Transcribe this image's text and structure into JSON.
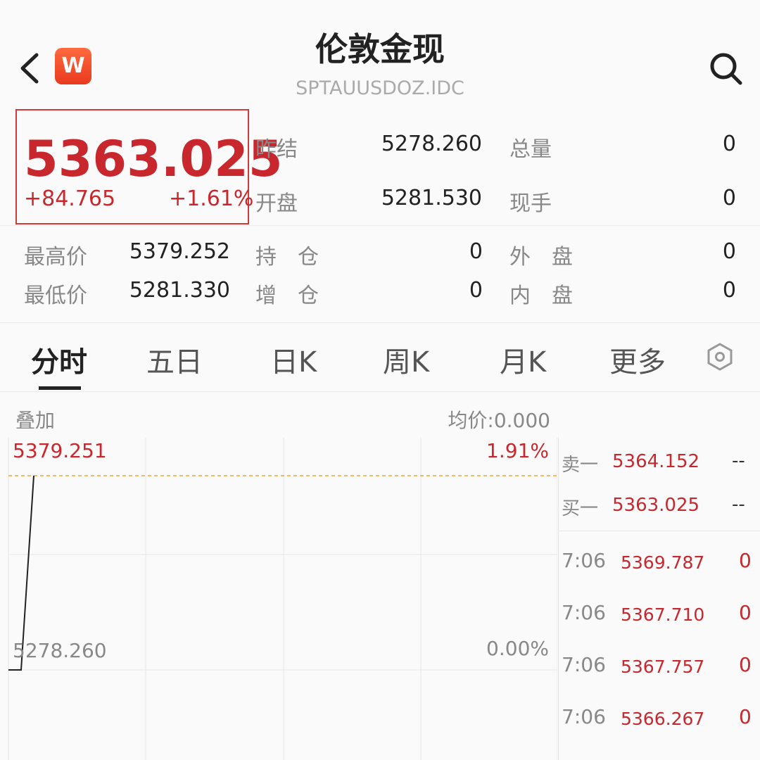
{
  "header": {
    "title": "伦敦金现",
    "code": "SPTAUUSDOZ.IDC",
    "badge": "W"
  },
  "quote": {
    "price": "5363.025",
    "change": "+84.765",
    "change_pct": "+1.61%"
  },
  "stats_top": [
    {
      "label": "昨结",
      "value": "5278.260"
    },
    {
      "label": "总量",
      "value": "0"
    },
    {
      "label": "开盘",
      "value": "5281.530"
    },
    {
      "label": "现手",
      "value": "0"
    }
  ],
  "stats_bottom": [
    {
      "label": "最高价",
      "value": "5379.252"
    },
    {
      "label": "持　仓",
      "value": "0"
    },
    {
      "label": "外　盘",
      "value": "0"
    },
    {
      "label": "最低价",
      "value": "5281.330"
    },
    {
      "label": "增　仓",
      "value": "0"
    },
    {
      "label": "内　盘",
      "value": "0"
    }
  ],
  "tabs": [
    "分时",
    "五日",
    "日K",
    "周K",
    "月K",
    "更多"
  ],
  "chart": {
    "overlay_label": "叠加",
    "avg_price": "均价:0.000",
    "high_price": "5379.251",
    "low_price": "5278.260",
    "high_pct": "1.91%",
    "low_pct": "0.00%"
  },
  "chart_data": {
    "type": "line",
    "x": [
      0,
      1,
      2
    ],
    "values": [
      5278.26,
      5278.26,
      5379.251
    ],
    "ylim": [
      5278.26,
      5379.251
    ],
    "reference_line": 5379.251
  },
  "order_book": [
    {
      "label": "卖一",
      "price": "5364.152",
      "qty": "--"
    },
    {
      "label": "买一",
      "price": "5363.025",
      "qty": "--"
    }
  ],
  "ticks": [
    {
      "time": "7:06",
      "price": "5369.787",
      "vol": "0"
    },
    {
      "time": "7:06",
      "price": "5367.710",
      "vol": "0"
    },
    {
      "time": "7:06",
      "price": "5367.757",
      "vol": "0"
    },
    {
      "time": "7:06",
      "price": "5366.267",
      "vol": "0"
    }
  ],
  "colors": {
    "up": "#c8282d",
    "muted": "#888888",
    "badge": "#ee4a24"
  }
}
